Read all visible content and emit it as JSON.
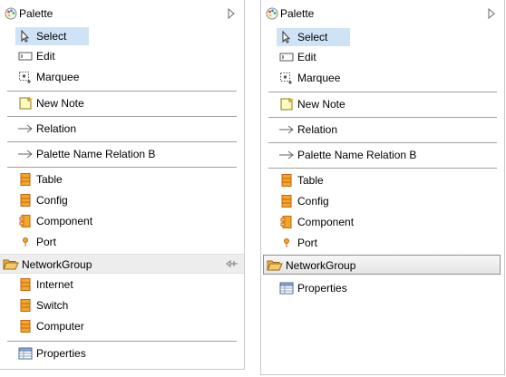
{
  "left_panel": {
    "title": "Palette",
    "tools": [
      {
        "label": "Select",
        "icon": "pointer-icon"
      },
      {
        "label": "Edit",
        "icon": "text-edit-icon"
      },
      {
        "label": "Marquee",
        "icon": "marquee-icon"
      }
    ],
    "note": {
      "label": "New Note",
      "icon": "note-icon"
    },
    "relations": [
      {
        "label": "Relation",
        "icon": "arrow-icon"
      },
      {
        "label": "Palette Name Relation B",
        "icon": "arrow-icon"
      }
    ],
    "elements": [
      {
        "label": "Table",
        "icon": "table-icon"
      },
      {
        "label": "Config",
        "icon": "table-icon"
      },
      {
        "label": "Component",
        "icon": "component-icon"
      },
      {
        "label": "Port",
        "icon": "port-icon"
      }
    ],
    "group": {
      "label": "NetworkGroup",
      "icon": "folder-open-icon"
    },
    "group_items": [
      {
        "label": "Internet",
        "icon": "table-icon"
      },
      {
        "label": "Switch",
        "icon": "table-icon"
      },
      {
        "label": "Computer",
        "icon": "table-icon"
      }
    ],
    "properties": {
      "label": "Properties",
      "icon": "properties-icon"
    }
  },
  "right_panel": {
    "title": "Palette",
    "tools": [
      {
        "label": "Select",
        "icon": "pointer-icon"
      },
      {
        "label": "Edit",
        "icon": "text-edit-icon"
      },
      {
        "label": "Marquee",
        "icon": "marquee-icon"
      }
    ],
    "note": {
      "label": "New Note",
      "icon": "note-icon"
    },
    "relations": [
      {
        "label": "Relation",
        "icon": "arrow-icon"
      },
      {
        "label": "Palette Name Relation B",
        "icon": "arrow-icon"
      }
    ],
    "elements": [
      {
        "label": "Table",
        "icon": "table-icon"
      },
      {
        "label": "Config",
        "icon": "table-icon"
      },
      {
        "label": "Component",
        "icon": "component-icon"
      },
      {
        "label": "Port",
        "icon": "port-icon"
      }
    ],
    "group": {
      "label": "NetworkGroup",
      "icon": "folder-open-icon"
    },
    "properties": {
      "label": "Properties",
      "icon": "properties-icon"
    }
  },
  "colors": {
    "selection": "#cfe3f7",
    "table_icon_fill": "#f5a623",
    "table_icon_border": "#c0661a",
    "note_fill": "#fffbbd",
    "folder_fill": "#f3c96b"
  }
}
